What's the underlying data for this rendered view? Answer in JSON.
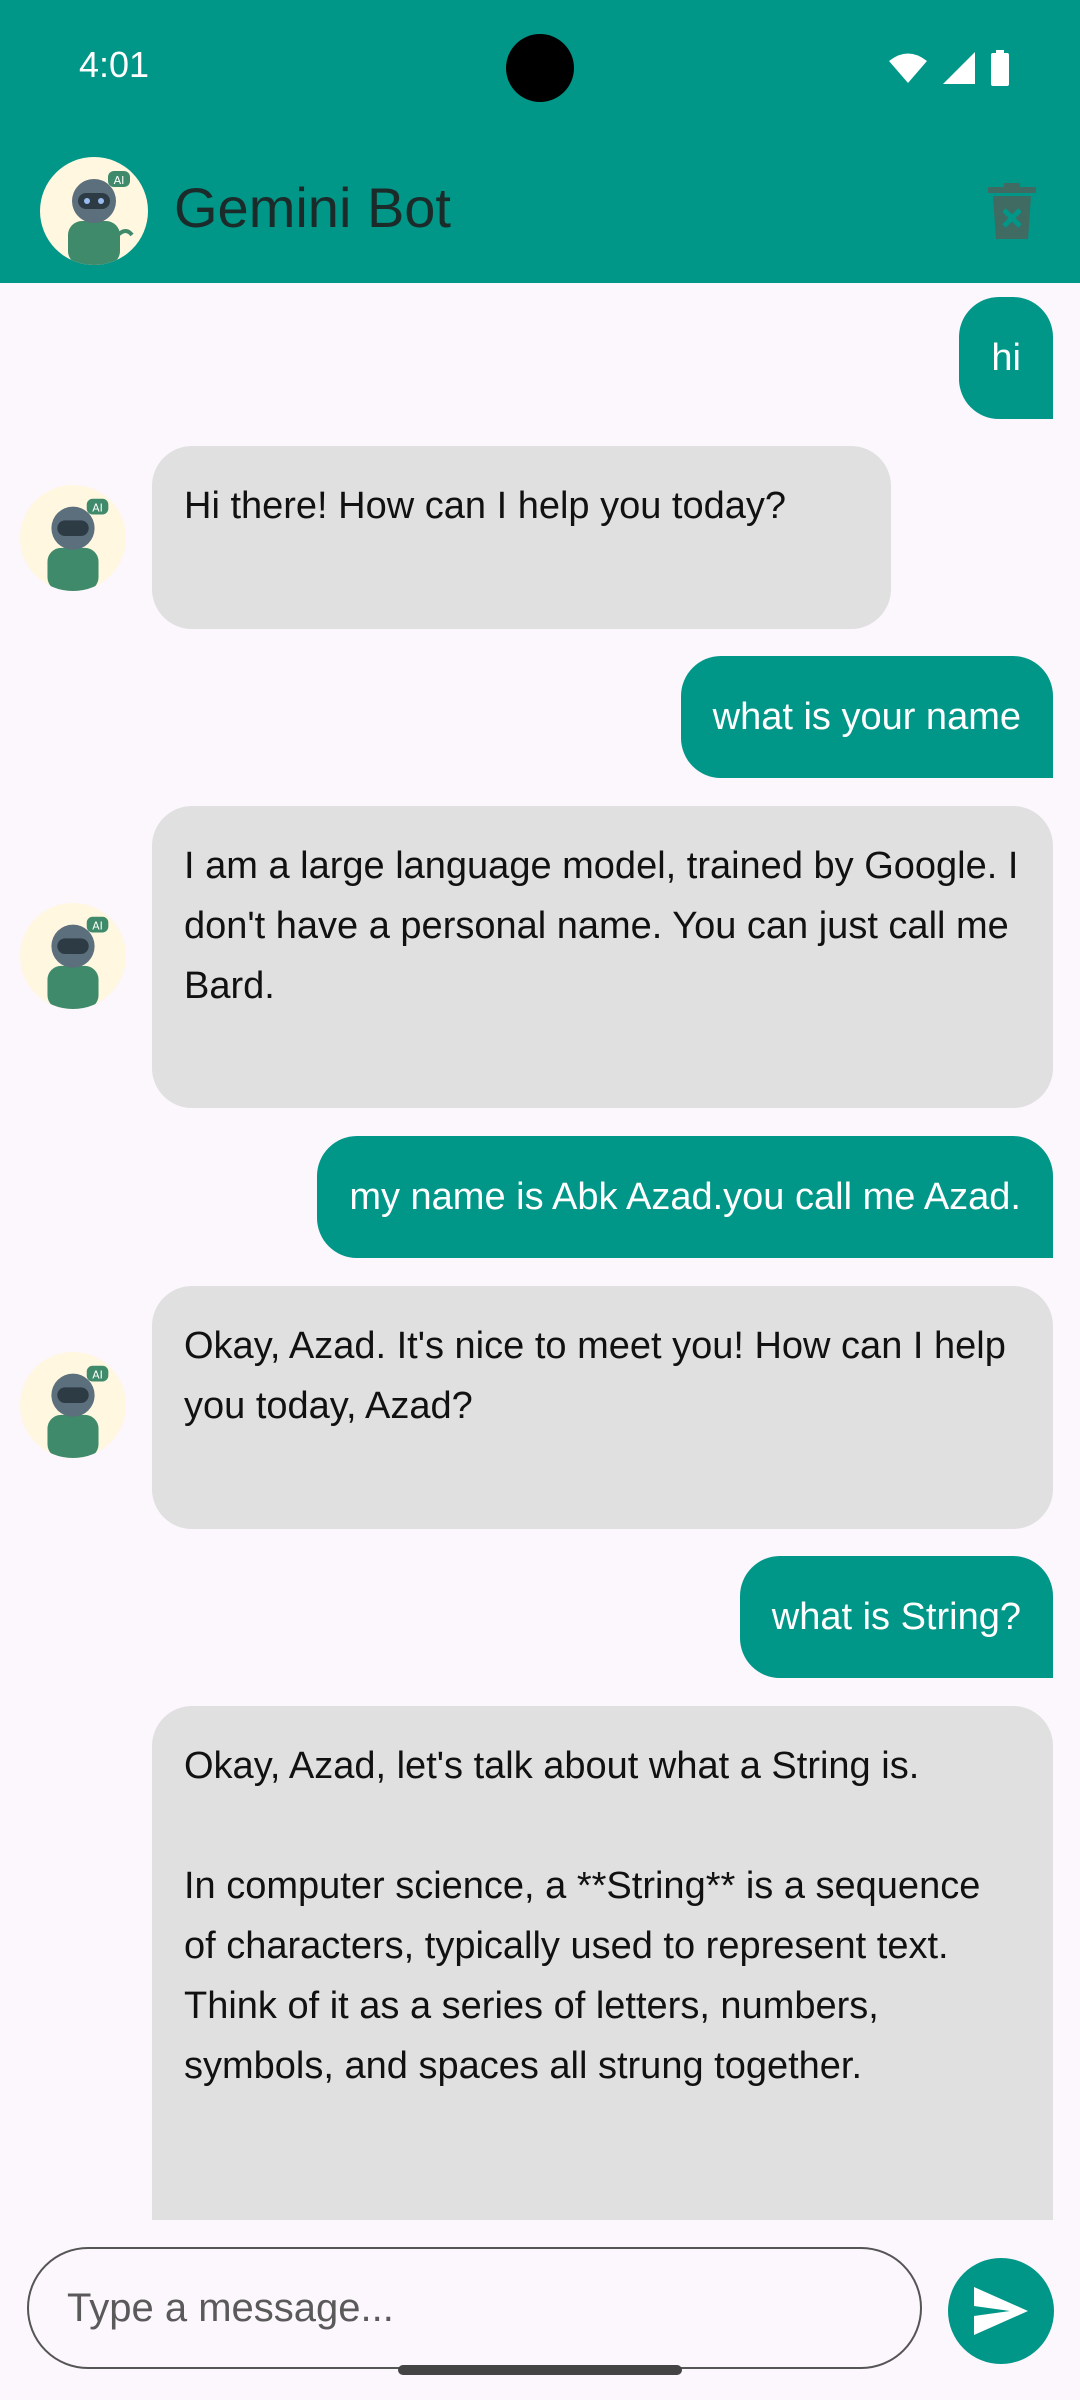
{
  "status": {
    "time": "4:01"
  },
  "app_bar": {
    "title": "Gemini Bot"
  },
  "messages": [
    {
      "role": "user",
      "text": "hi"
    },
    {
      "role": "bot",
      "text": "Hi there! How can I help you today?"
    },
    {
      "role": "user",
      "text": "what is your name"
    },
    {
      "role": "bot",
      "text": "I am a large language model, trained by Google. I don't have a personal name. You can just call me Bard."
    },
    {
      "role": "user",
      "text": "my name is Abk Azad.you call me Azad."
    },
    {
      "role": "bot",
      "text": "Okay, Azad. It's nice to meet you! How can I help you today, Azad?"
    },
    {
      "role": "user",
      "text": "what is String?"
    },
    {
      "role": "bot",
      "text": "Okay, Azad, let's talk about what a String is.\n\nIn computer science, a **String** is a sequence of characters, typically used to represent text. Think of it as a series of letters, numbers, symbols, and spaces all strung together."
    }
  ],
  "input": {
    "placeholder": "Type a message..."
  },
  "icons": {
    "app_avatar": "robot-avatar-icon",
    "delete": "trash-icon",
    "send": "send-icon"
  },
  "colors": {
    "primary": "#009688",
    "bot_bubble": "#e0e0e0",
    "background": "#fcf6fd"
  }
}
